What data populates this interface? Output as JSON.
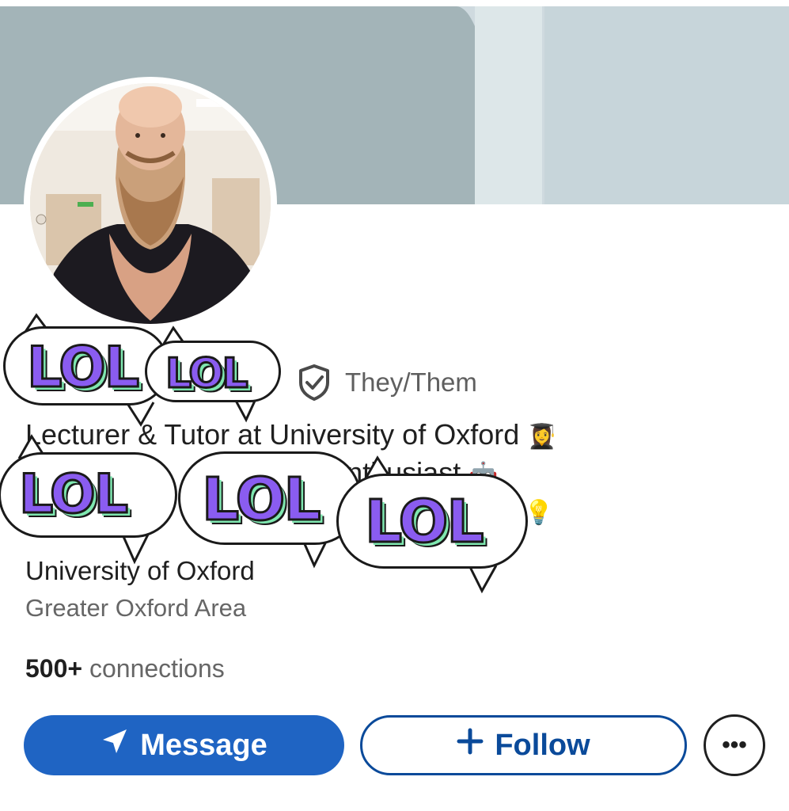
{
  "profile": {
    "pronouns": "They/Them",
    "headline": [
      {
        "text": "Lecturer & Tutor at University of Oxford ",
        "emoji": "👩‍🎓"
      },
      {
        "text": "                                  AI Enthusiast ",
        "emoji": "🤖"
      },
      {
        "text": "",
        "emoji": "💡"
      }
    ],
    "organization": "University of Oxford",
    "location": "Greater Oxford Area",
    "connections_count": "500+",
    "connections_label": "connections"
  },
  "actions": {
    "message_label": "Message",
    "follow_label": "Follow",
    "more_label": "•••"
  },
  "stickers": {
    "text": "LOL"
  },
  "colors": {
    "primary_button": "#1f64c3",
    "follow_border": "#0a4a9a",
    "sticker_fill": "#8a5cf0",
    "sticker_shadow": "#7fe7b0"
  },
  "icons": {
    "verified": "shield-check-icon",
    "message": "send-icon",
    "follow": "plus-icon",
    "more": "more-horizontal-icon"
  }
}
